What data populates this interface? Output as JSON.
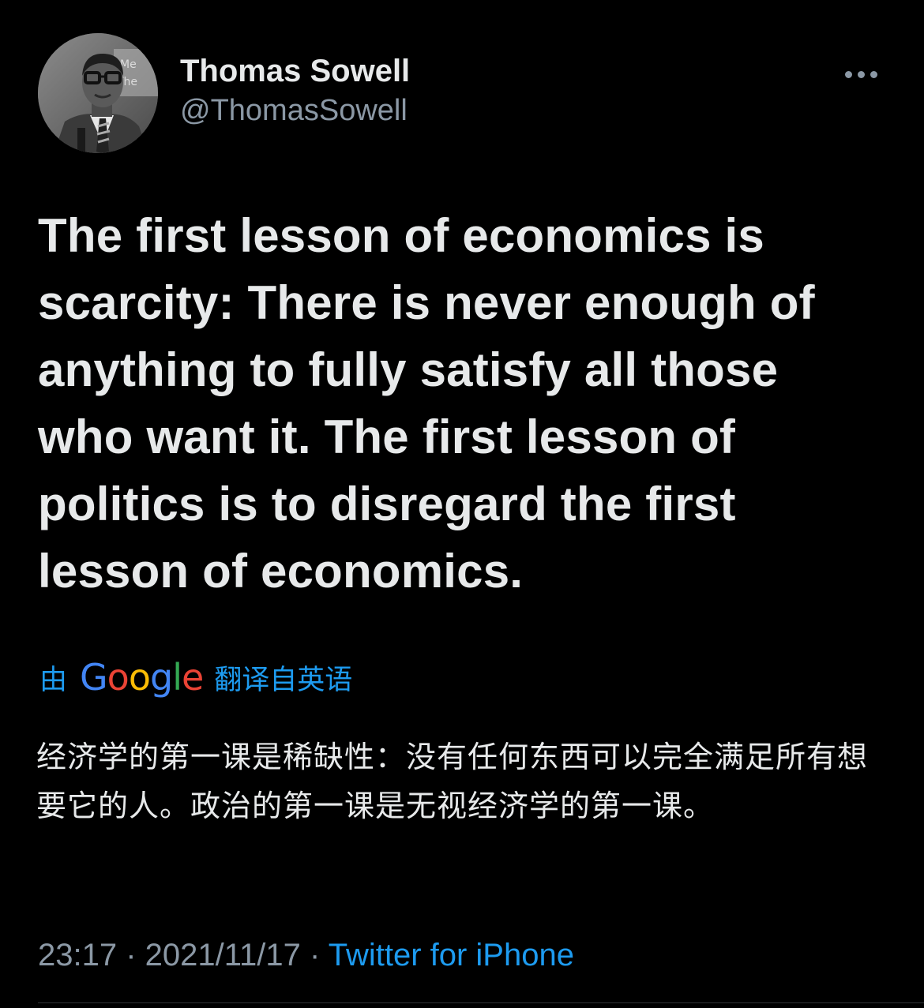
{
  "author": {
    "display_name": "Thomas Sowell",
    "handle": "@ThomasSowell",
    "avatar_icon": "profile-photo"
  },
  "more_icon": "more-horizontal-icon",
  "tweet": {
    "text": "The first lesson of economics is scarcity: There is never enough of anything to fully satisfy all those who want it. The first lesson of politics is to disregard the first lesson of economics."
  },
  "translation": {
    "prefix": "由",
    "provider": "Google",
    "suffix": "翻译自英语",
    "text": "经济学的第一课是稀缺性：没有任何东西可以完全满足所有想要它的人。政治的第一课是无视经济学的第一课。"
  },
  "meta": {
    "time": "23:17",
    "sep1": " · ",
    "date": "2021/11/17",
    "sep2": " · ",
    "source": "Twitter for iPhone"
  },
  "colors": {
    "background": "#000000",
    "text": "#e7e9ea",
    "secondary": "#8b98a5",
    "link": "#1d9bf0",
    "google_blue": "#4285f4",
    "google_red": "#ea4335",
    "google_yellow": "#fbbc05",
    "google_green": "#34a853"
  }
}
